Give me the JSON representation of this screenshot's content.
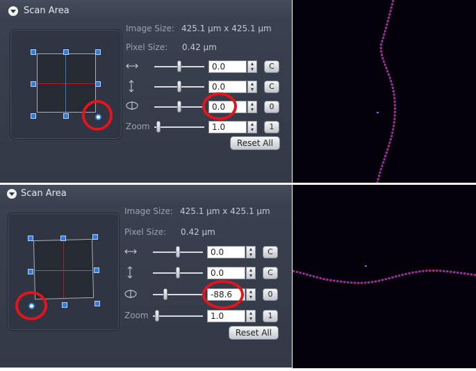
{
  "panels": [
    {
      "header": {
        "title": "Scan Area"
      },
      "image_size": {
        "label": "Image Size:",
        "value": "425.1 µm x 425.1 µm"
      },
      "pixel_size": {
        "label": "Pixel Size:",
        "value": "0.42 µm"
      },
      "offset_x": {
        "value": "0.0",
        "button": "C"
      },
      "offset_y": {
        "value": "0.0",
        "button": "C"
      },
      "rotation": {
        "value": "0.0",
        "button": "0"
      },
      "zoom": {
        "label": "Zoom",
        "value": "1.0",
        "button": "1"
      },
      "reset_label": "Reset All"
    },
    {
      "header": {
        "title": "Scan Area"
      },
      "image_size": {
        "label": "Image Size:",
        "value": "425.1 µm x 425.1 µm"
      },
      "pixel_size": {
        "label": "Pixel Size:",
        "value": "0.42 µm"
      },
      "offset_x": {
        "value": "0.0",
        "button": "C"
      },
      "offset_y": {
        "value": "0.0",
        "button": "C"
      },
      "rotation": {
        "value": "-88.6",
        "button": "0"
      },
      "zoom": {
        "label": "Zoom",
        "value": "1.0",
        "button": "1"
      },
      "reset_label": "Reset All"
    }
  ],
  "icons": {
    "collapse": "collapse-arrow-icon",
    "horizontal_offset": "horizontal-arrows-icon",
    "vertical_offset": "vertical-arrows-icon",
    "rotation": "rotation-icon",
    "spin": "spin-up-down-icon"
  },
  "colors": {
    "annotation_circle": "#e3141c",
    "handle": "#2f7de0",
    "crosshair_red": "#b0202a",
    "crosshair_blue": "#3a78d0",
    "fluorescence": "#c8307e"
  }
}
